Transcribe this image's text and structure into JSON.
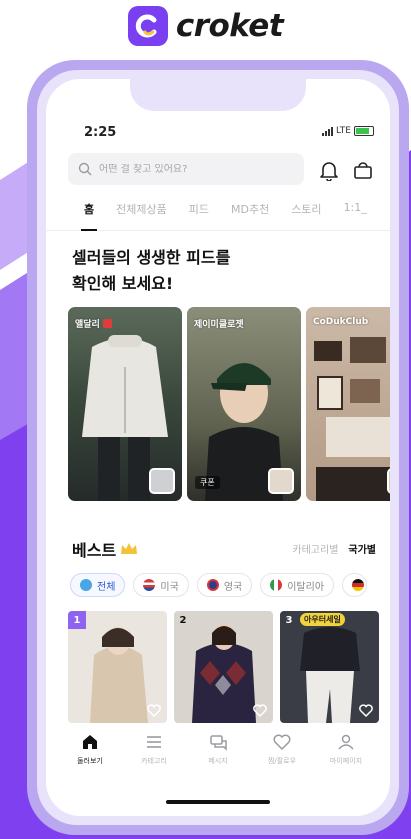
{
  "brand": {
    "name": "croket"
  },
  "status_bar": {
    "time": "2:25",
    "network": "LTE"
  },
  "search": {
    "placeholder": "어떤 걸 찾고 있어요?"
  },
  "tabs": [
    {
      "label": "홈",
      "active": true
    },
    {
      "label": "전체제상품"
    },
    {
      "label": "피드"
    },
    {
      "label": "MD추천"
    },
    {
      "label": "스토리"
    },
    {
      "label": "1:1_"
    }
  ],
  "feed": {
    "heading_line1": "셀러들의 생생한 피드를",
    "heading_line2": "확인해 보세요!",
    "cards": [
      {
        "seller": "앨달리"
      },
      {
        "seller": "제이미클로젯",
        "tag": "쿠폰"
      },
      {
        "seller": "CoDukClub"
      }
    ]
  },
  "best": {
    "title": "베스트",
    "link_category": "카테고리별",
    "link_country": "국가별",
    "countries": [
      {
        "label": "전체",
        "active": true
      },
      {
        "label": "미국"
      },
      {
        "label": "영국"
      },
      {
        "label": "이탈리아"
      }
    ],
    "products": [
      {
        "rank": "1"
      },
      {
        "rank": "2"
      },
      {
        "rank": "3",
        "badge": "아우터세일"
      }
    ]
  },
  "bottom_nav": [
    {
      "label": "둘러보기",
      "active": true
    },
    {
      "label": "카테고리"
    },
    {
      "label": "메시지"
    },
    {
      "label": "찜/팔로우"
    },
    {
      "label": "마이페이지"
    }
  ],
  "colors": {
    "accent": "#7b3ff2",
    "background_purple": "#7f41f0",
    "rank_badge": "#8e63f0",
    "sale_badge": "#f3d33a"
  }
}
